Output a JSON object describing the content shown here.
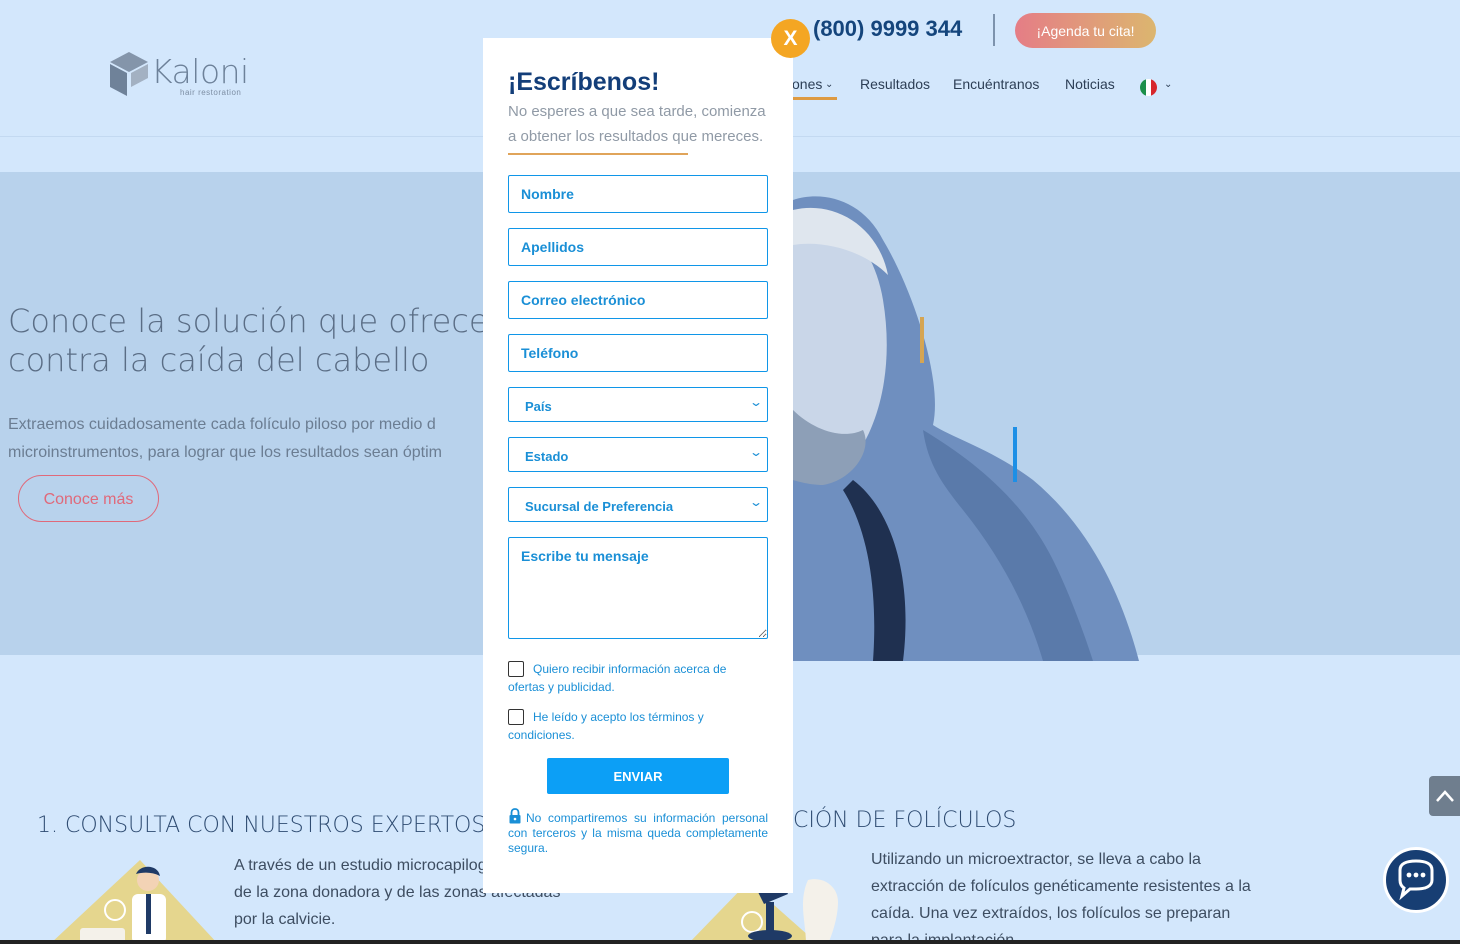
{
  "header": {
    "logo_word": "Kaloni",
    "logo_sub": "hair restoration",
    "phone": "(800) 9999 344",
    "cta_label": "¡Agenda tu cita!",
    "nav": [
      {
        "label": "ones"
      },
      {
        "label": "Resultados"
      },
      {
        "label": "Encuéntranos"
      },
      {
        "label": "Noticias"
      }
    ],
    "flag_colors": [
      "#1b8f4a",
      "#ffffff",
      "#d7262c"
    ]
  },
  "hero": {
    "title_line1": "Conoce la solución que ofrece",
    "title_line2": "contra la caída del cabello",
    "text_line1": "Extraemos cuidadosamente cada folículo piloso por medio d",
    "text_line2": "microinstrumentos, para lograr que los resultados sean óptim",
    "button": "Conoce más"
  },
  "steps": {
    "step1_title": "1. CONSULTA CON NUESTROS EXPERTOS",
    "step1_text": "A través de un estudio microcapilog densidad de la zona donadora y de las zonas afectadas por la calvicie.",
    "step2_title": "CIÓN DE FOLÍCULOS",
    "step2_text": "Utilizando un microextractor, se lleva a cabo la extracción de folículos genéticamente resistentes a la caída. Una vez extraídos, los folículos se preparan para la implantación."
  },
  "modal": {
    "close_label": "X",
    "title": "¡Escríbenos!",
    "subtitle": "No esperes a que sea tarde, comienza a obtener los resultados que mereces.",
    "fields": {
      "nombre": "Nombre",
      "apellidos": "Apellidos",
      "correo": "Correo electrónico",
      "telefono": "Teléfono",
      "mensaje": "Escribe tu mensaje"
    },
    "selects": {
      "pais": "País",
      "estado": "Estado",
      "sucursal": "Sucursal de Preferencia"
    },
    "checkbox_offers": "Quiero recibir información acerca de ofertas y publicidad.",
    "checkbox_terms": "He leído y acepto los términos y condiciones.",
    "submit": "ENVIAR",
    "privacy": "No compartiremos su información personal con terceros y la misma queda completamente segura."
  },
  "colors": {
    "brand_blue": "#133e79",
    "field_blue": "#1096e8",
    "accent_orange": "#f4a623",
    "cta_pink": "#e57d86"
  },
  "icons": [
    "logo-cube-icon",
    "chevron-down-icon",
    "mexico-flag-icon",
    "lock-icon",
    "scroll-top-icon",
    "chat-bubble-icon"
  ]
}
